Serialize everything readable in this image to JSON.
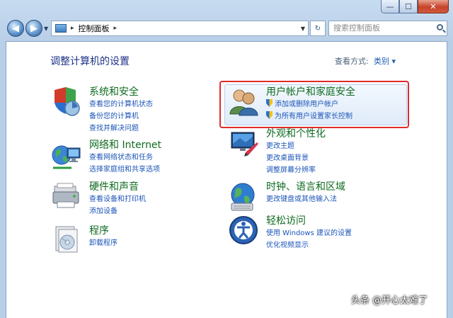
{
  "titlebar": {
    "min_glyph": "—",
    "max_glyph": "☐",
    "close_glyph": "✕"
  },
  "nav": {
    "back_glyph": "◀",
    "forward_glyph": "▶",
    "address_path": "控制面板",
    "address_sep": "▸",
    "search_placeholder": "搜索控制面板"
  },
  "header": {
    "title": "调整计算机的设置",
    "view_by_label": "查看方式:",
    "view_by_value": "类别 ▾"
  },
  "categories_left": [
    {
      "title": "系统和安全",
      "links": [
        "查看您的计算机状态",
        "备份您的计算机",
        "查找并解决问题"
      ]
    },
    {
      "title": "网络和 Internet",
      "links": [
        "查看网络状态和任务",
        "选择家庭组和共享选项"
      ]
    },
    {
      "title": "硬件和声音",
      "links": [
        "查看设备和打印机",
        "添加设备"
      ]
    },
    {
      "title": "程序",
      "links": [
        "卸载程序"
      ]
    }
  ],
  "categories_right": [
    {
      "title": "用户帐户和家庭安全",
      "links": [
        "添加或删除用户帐户",
        "为所有用户设置家长控制"
      ]
    },
    {
      "title": "外观和个性化",
      "links": [
        "更改主题",
        "更改桌面背景",
        "调整屏幕分辨率"
      ]
    },
    {
      "title": "时钟、语言和区域",
      "links": [
        "更改键盘或其他输入法"
      ]
    },
    {
      "title": "轻松访问",
      "links": [
        "使用 Windows 建议的设置",
        "优化视频显示"
      ]
    }
  ],
  "watermark": "头条 @开心太难了",
  "colors": {
    "category_title": "#0e6a1f",
    "link": "#1c55b8",
    "highlight_box": "#e02b2b"
  }
}
